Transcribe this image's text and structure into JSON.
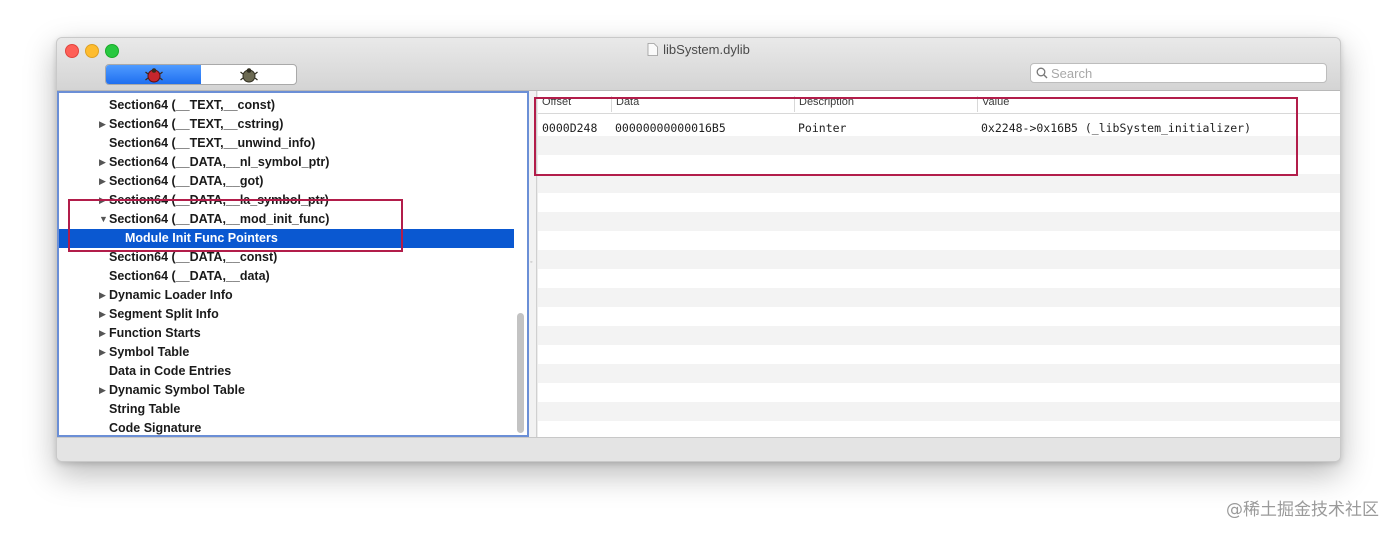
{
  "window": {
    "title": "libSystem.dylib"
  },
  "toolbar": {
    "segment_left_icon": "bug-icon-red",
    "segment_right_icon": "bug-icon-gray",
    "search_placeholder": "Search"
  },
  "tree": {
    "items": [
      {
        "label": "Section64 (__TEXT,__const)",
        "expander": ""
      },
      {
        "label": "Section64 (__TEXT,__cstring)",
        "expander": "▶"
      },
      {
        "label": "Section64 (__TEXT,__unwind_info)",
        "expander": ""
      },
      {
        "label": "Section64 (__DATA,__nl_symbol_ptr)",
        "expander": "▶"
      },
      {
        "label": "Section64 (__DATA,__got)",
        "expander": "▶"
      },
      {
        "label": "Section64 (__DATA,__la_symbol_ptr)",
        "expander": "▶"
      },
      {
        "label": "Section64 (__DATA,__mod_init_func)",
        "expander": "▼"
      },
      {
        "label": "Module Init Func Pointers",
        "expander": "",
        "selected": true
      },
      {
        "label": "Section64 (__DATA,__const)",
        "expander": ""
      },
      {
        "label": "Section64 (__DATA,__data)",
        "expander": ""
      },
      {
        "label": "Dynamic Loader Info",
        "expander": "▶"
      },
      {
        "label": "Segment Split Info",
        "expander": "▶"
      },
      {
        "label": "Function Starts",
        "expander": "▶"
      },
      {
        "label": "Symbol Table",
        "expander": "▶"
      },
      {
        "label": "Data in Code Entries",
        "expander": ""
      },
      {
        "label": "Dynamic Symbol Table",
        "expander": "▶"
      },
      {
        "label": "String Table",
        "expander": ""
      },
      {
        "label": "Code Signature",
        "expander": ""
      }
    ]
  },
  "table": {
    "columns": [
      "Offset",
      "Data",
      "Description",
      "Value"
    ],
    "rows": [
      [
        "0000D248",
        "00000000000016B5",
        "Pointer",
        "0x2248->0x16B5 (_libSystem_initializer)"
      ]
    ]
  },
  "watermark": "@稀土掘金技术社区",
  "colors": {
    "selection": "#0a58d1",
    "annotation": "#b21d4a",
    "pane_focus_border": "#6b8fd6"
  }
}
